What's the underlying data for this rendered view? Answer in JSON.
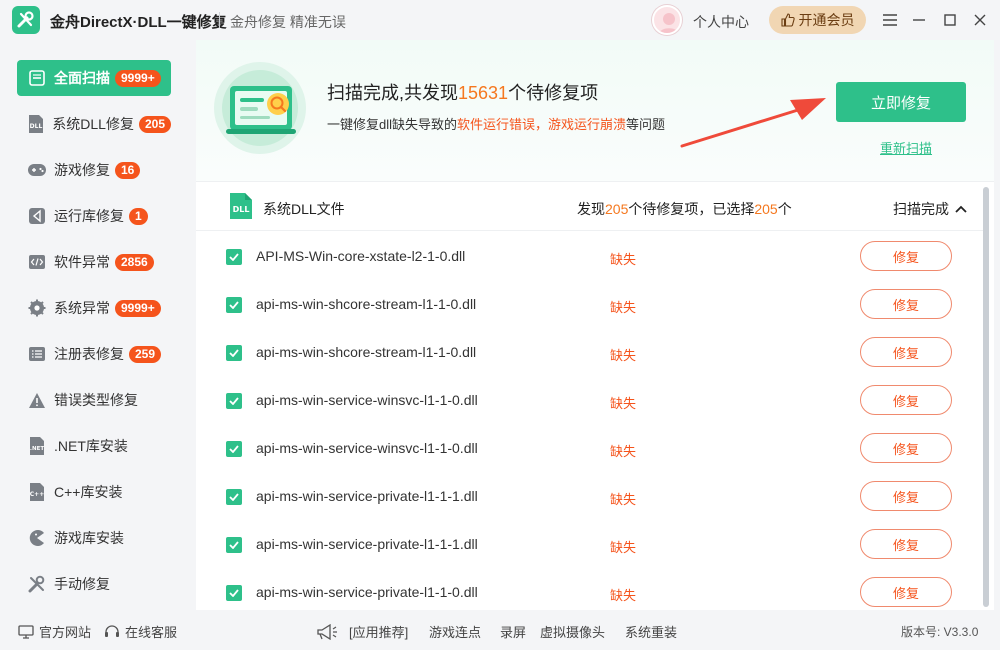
{
  "app": {
    "title": "金舟DirectX·DLL一键修复",
    "slogan": "金舟修复 精准无误",
    "user_center": "个人中心",
    "vip_label": "开通会员",
    "logo_icon": "wrench-screwdriver-icon"
  },
  "colors": {
    "accent": "#2ec08a",
    "badge": "#f5541c",
    "highlight": "#f5781f",
    "vip": "#f1d6b3"
  },
  "sidebar": {
    "items": [
      {
        "label": "全面扫描",
        "badge": "9999+",
        "icon": "scan-icon",
        "active": true
      },
      {
        "label": "系统DLL修复",
        "badge": "205",
        "icon": "dll-icon"
      },
      {
        "label": "游戏修复",
        "badge": "16",
        "icon": "gamepad-icon"
      },
      {
        "label": "运行库修复",
        "badge": "1",
        "icon": "vs-icon"
      },
      {
        "label": "软件异常",
        "badge": "2856",
        "icon": "code-icon"
      },
      {
        "label": "系统异常",
        "badge": "9999+",
        "icon": "gear-icon"
      },
      {
        "label": "注册表修复",
        "badge": "259",
        "icon": "list-icon"
      },
      {
        "label": "错误类型修复",
        "badge": "",
        "icon": "warning-icon"
      },
      {
        "label": ".NET库安装",
        "badge": "",
        "icon": "net-icon"
      },
      {
        "label": "C++库安装",
        "badge": "",
        "icon": "cpp-icon"
      },
      {
        "label": "游戏库安装",
        "badge": "",
        "icon": "pacman-icon"
      },
      {
        "label": "手动修复",
        "badge": "",
        "icon": "tools-icon"
      }
    ]
  },
  "hero": {
    "line1_prefix": "扫描完成,共发现",
    "line1_count": "15631",
    "line1_suffix": "个待修复项",
    "line2_prefix": "一键修复dll缺失导致的",
    "line2_warn": "软件运行错误，游戏运行崩溃",
    "line2_suffix": "等问题",
    "fix_all_label": "立即修复",
    "rescan_label": "重新扫描"
  },
  "section": {
    "title": "系统DLL文件",
    "summary_prefix": "发现",
    "found_count": "205",
    "summary_mid": "个待修复项，已选择",
    "selected_count": "205",
    "summary_suffix": "个",
    "status": "扫描完成"
  },
  "rows": [
    {
      "name": "API-MS-Win-core-xstate-l2-1-0.dll",
      "status": "缺失",
      "action": "修复",
      "checked": true
    },
    {
      "name": "api-ms-win-shcore-stream-l1-1-0.dll",
      "status": "缺失",
      "action": "修复",
      "checked": true
    },
    {
      "name": "api-ms-win-shcore-stream-l1-1-0.dll",
      "status": "缺失",
      "action": "修复",
      "checked": true
    },
    {
      "name": "api-ms-win-service-winsvc-l1-1-0.dll",
      "status": "缺失",
      "action": "修复",
      "checked": true
    },
    {
      "name": "api-ms-win-service-winsvc-l1-1-0.dll",
      "status": "缺失",
      "action": "修复",
      "checked": true
    },
    {
      "name": "api-ms-win-service-private-l1-1-1.dll",
      "status": "缺失",
      "action": "修复",
      "checked": true
    },
    {
      "name": "api-ms-win-service-private-l1-1-1.dll",
      "status": "缺失",
      "action": "修复",
      "checked": true
    },
    {
      "name": "api-ms-win-service-private-l1-1-0.dll",
      "status": "缺失",
      "action": "修复",
      "checked": true
    }
  ],
  "footer": {
    "website": "官方网站",
    "support": "在线客服",
    "recommend": "[应用推荐]",
    "links": [
      "游戏连点",
      "录屏",
      "虚拟摄像头",
      "系统重装"
    ],
    "version": "版本号: V3.3.0"
  }
}
